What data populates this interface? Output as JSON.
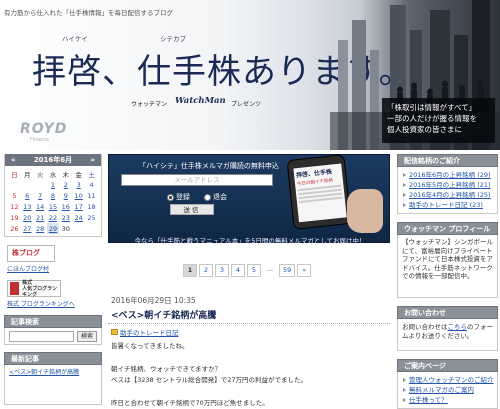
{
  "header": {
    "tagline": "有力筋から仕入れた「仕手株情報」を毎日配信するブログ",
    "title": "拝啓、仕手株あります。",
    "ruby_haikei": "ハイケイ",
    "ruby_shitekabu": "シテカブ",
    "subtitle_pre": "ウォッチマン",
    "subtitle_logo": "WatchMan",
    "subtitle_post": "プレゼンツ",
    "brand_logo": "ROYD",
    "brand_sub": "Finance",
    "promo_lines": [
      "「株取引は情報がすべて」",
      "一部の人だけが握る情報を",
      "個人投資家の皆さまに"
    ]
  },
  "calendar": {
    "header": "2016年6月",
    "prev": "«",
    "next": "»",
    "weekdays": [
      "日",
      "月",
      "火",
      "水",
      "木",
      "金",
      "土"
    ],
    "rows": [
      [
        "",
        "",
        "",
        "1",
        "2",
        "3",
        "4"
      ],
      [
        "5",
        "6",
        "7",
        "8",
        "9",
        "10",
        "11"
      ],
      [
        "12",
        "13",
        "14",
        "15",
        "16",
        "17",
        "18"
      ],
      [
        "19",
        "20",
        "21",
        "22",
        "23",
        "24",
        "25"
      ],
      [
        "26",
        "27",
        "28",
        "29",
        "30",
        "",
        ""
      ]
    ]
  },
  "badges": {
    "blog_label": "株ブログ",
    "blog_link": "にほんブログ村",
    "rank_line1": "株式",
    "rank_line2": "人気ブログランキング",
    "rank_link": "株式 ブログランキングへ"
  },
  "search": {
    "title": "記事検索",
    "button": "検索"
  },
  "recent": {
    "title": "最新記事",
    "items": [
      "<ベス>朝イチ銘柄が高騰"
    ]
  },
  "mail": {
    "title": "「ハイシテ」仕手株メルマガ購読の無料申込",
    "placeholder": "メールアドレス",
    "radio_register": "登録",
    "radio_cancel": "退会",
    "send": "送信",
    "note": "今なら「仕手筋と戦うマニュアル本」を5日間の無料メルマガとしてお届け中！",
    "phone_title": "拝啓、仕手株",
    "phone_sub": "今日の朝イチ銘柄"
  },
  "pager": [
    "1",
    "2",
    "3",
    "4",
    "5",
    "...",
    "59",
    "»"
  ],
  "post": {
    "date": "2016年06月29日 10:35",
    "title": "<ベス>朝イチ銘柄が高騰",
    "category": "助手のトレード日記",
    "lines": [
      "皆暑くなってきましたね。",
      "朝イチ銘柄、ウォッチできてますか？",
      "ベスは【3238 セントラル総合開発】で27万円の利益がでました。",
      "昨日と合わせて朝イチ銘柄で70万円ほど魚せました。"
    ]
  },
  "right": {
    "delivery_title": "配信銘柄のご紹介",
    "delivery_items": [
      "2016年6月の上昇銘柄 (29)",
      "2016年5月の上昇銘柄 (21)",
      "2016年4月の上昇銘柄 (25)",
      "助手のトレード日記 (23)"
    ],
    "profile_title": "ウォッチマン プロフィール",
    "profile_text": "【ウォッチマン】シンガポールにて、富裕層向けプライベートファンドにて日本株式投資をアドバイス。仕手筋ネットワークでの情報を一部配信中。",
    "contact_title": "お問い合わせ",
    "contact_text_pre": "お問い合わせは",
    "contact_link": "こちら",
    "contact_text_post": "のフォームよりお送りください。",
    "guide_title": "ご案内ページ",
    "guide_items": [
      "管理人ウォッチマンのご紹介",
      "無料メルマガのご案内",
      "仕手株って？"
    ]
  },
  "colors": {
    "brand_navy": "#1a2a55",
    "link": "#2255aa",
    "box_head": "#8a9098",
    "mail_bg": "#1c3b62"
  }
}
